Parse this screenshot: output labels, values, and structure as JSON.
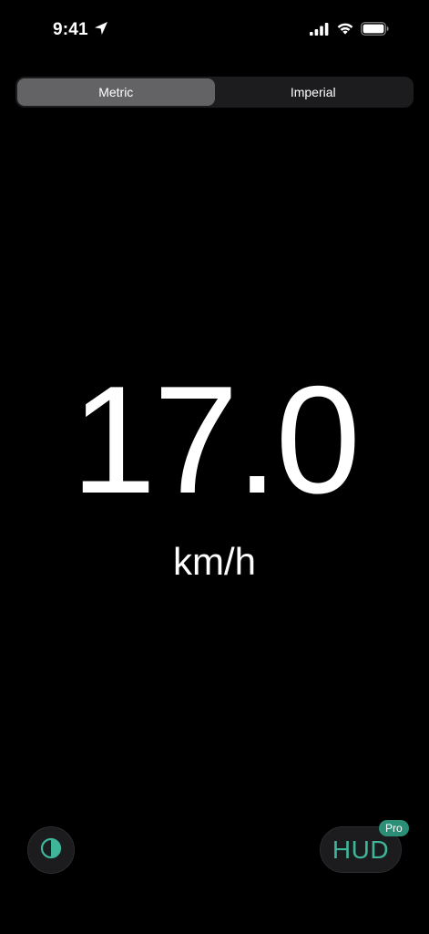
{
  "status_bar": {
    "time": "9:41",
    "location_icon": "location-arrow-icon",
    "signal_icon": "cellular-signal-icon",
    "wifi_icon": "wifi-icon",
    "battery_icon": "battery-icon"
  },
  "unit_selector": {
    "options": [
      "Metric",
      "Imperial"
    ],
    "selected": "Metric"
  },
  "speed": {
    "value": "17.0",
    "unit": "km/h"
  },
  "controls": {
    "theme_icon": "contrast-icon",
    "hud_label": "HUD",
    "pro_badge": "Pro"
  },
  "colors": {
    "background": "#000000",
    "accent": "#3fb59a",
    "badge": "#2b8f78",
    "segment_selected": "#636366",
    "segment_track": "#1c1c1e"
  }
}
